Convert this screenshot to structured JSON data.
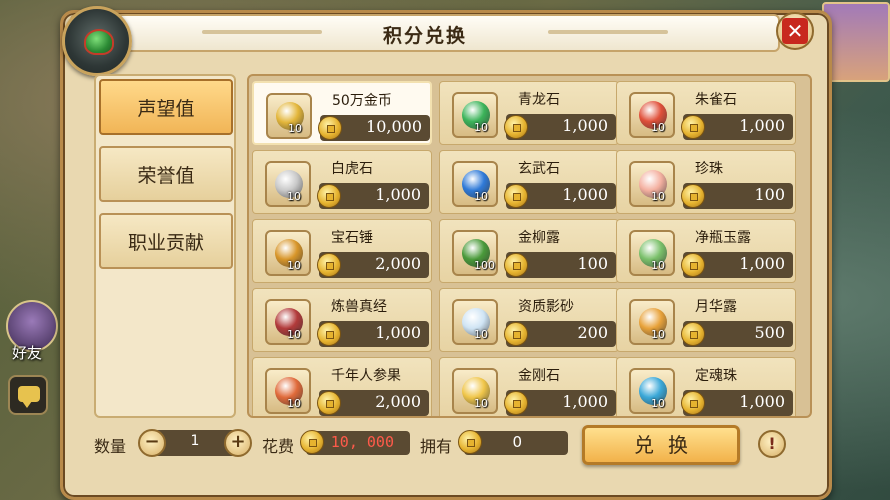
{
  "dialog": {
    "title": "积分兑换",
    "close_icon": "close-icon"
  },
  "sidebar": {
    "tabs": [
      {
        "label": "声望值",
        "active": true
      },
      {
        "label": "荣誉值",
        "active": false
      },
      {
        "label": "职业贡献",
        "active": false
      }
    ]
  },
  "items": [
    {
      "name": "50万金币",
      "qty": "10",
      "price": "10,000",
      "color": "#e3b63a",
      "selected": true
    },
    {
      "name": "青龙石",
      "qty": "10",
      "price": "1,000",
      "color": "#3cb45a",
      "selected": false
    },
    {
      "name": "朱雀石",
      "qty": "10",
      "price": "1,000",
      "color": "#e0503a",
      "selected": false
    },
    {
      "name": "白虎石",
      "qty": "10",
      "price": "1,000",
      "color": "#c9c9c9",
      "selected": false
    },
    {
      "name": "玄武石",
      "qty": "10",
      "price": "1,000",
      "color": "#2f7ad8",
      "selected": false
    },
    {
      "name": "珍珠",
      "qty": "10",
      "price": "100",
      "color": "#f4b0a0",
      "selected": false
    },
    {
      "name": "宝石锤",
      "qty": "10",
      "price": "2,000",
      "color": "#d8962a",
      "selected": false
    },
    {
      "name": "金柳露",
      "qty": "100",
      "price": "100",
      "color": "#4a9a3a",
      "selected": false
    },
    {
      "name": "净瓶玉露",
      "qty": "10",
      "price": "1,000",
      "color": "#7ac06a",
      "selected": false
    },
    {
      "name": "炼兽真经",
      "qty": "10",
      "price": "1,000",
      "color": "#b23a3a",
      "selected": false
    },
    {
      "name": "资质影砂",
      "qty": "10",
      "price": "200",
      "color": "#cfe4f4",
      "selected": false
    },
    {
      "name": "月华露",
      "qty": "10",
      "price": "500",
      "color": "#e8a23a",
      "selected": false
    },
    {
      "name": "千年人参果",
      "qty": "10",
      "price": "2,000",
      "color": "#e06a3a",
      "selected": false
    },
    {
      "name": "金刚石",
      "qty": "10",
      "price": "1,000",
      "color": "#f0c64a",
      "selected": false
    },
    {
      "name": "定魂珠",
      "qty": "10",
      "price": "1,000",
      "color": "#3aa8d8",
      "selected": false
    }
  ],
  "footer": {
    "quantity_label": "数量",
    "quantity_value": "1",
    "minus": "−",
    "plus": "+",
    "cost_label": "花费",
    "cost_value": "10, 000",
    "own_label": "拥有",
    "own_value": "0",
    "exchange_label": "兑换",
    "info_label": "!"
  },
  "background": {
    "left_label": "好友"
  }
}
